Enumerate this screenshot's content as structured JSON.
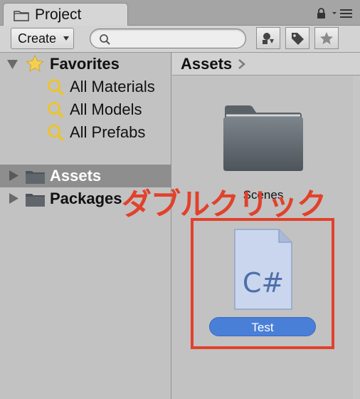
{
  "window": {
    "tab_title": "Project"
  },
  "toolbar": {
    "create_label": "Create",
    "search_placeholder": "",
    "search_value": ""
  },
  "sidebar": {
    "favorites_label": "Favorites",
    "favorites": [
      {
        "label": "All Materials"
      },
      {
        "label": "All Models"
      },
      {
        "label": "All Prefabs"
      }
    ],
    "roots": [
      {
        "label": "Assets",
        "selected": true
      },
      {
        "label": "Packages",
        "selected": false
      }
    ]
  },
  "main": {
    "breadcrumb": "Assets",
    "items": [
      {
        "label": "Scenes",
        "type": "folder",
        "icon": "folder-icon"
      },
      {
        "label": "Test",
        "type": "csharp-script",
        "icon": "csharp-file-icon",
        "icon_text": "C#",
        "selected": true
      }
    ]
  },
  "annotation": {
    "text": "ダブルクリック",
    "color": "#e2412b"
  },
  "colors": {
    "selection": "#4a7fd8",
    "tree_selection": "#8e8e8e",
    "highlight_box": "#e2412b"
  }
}
